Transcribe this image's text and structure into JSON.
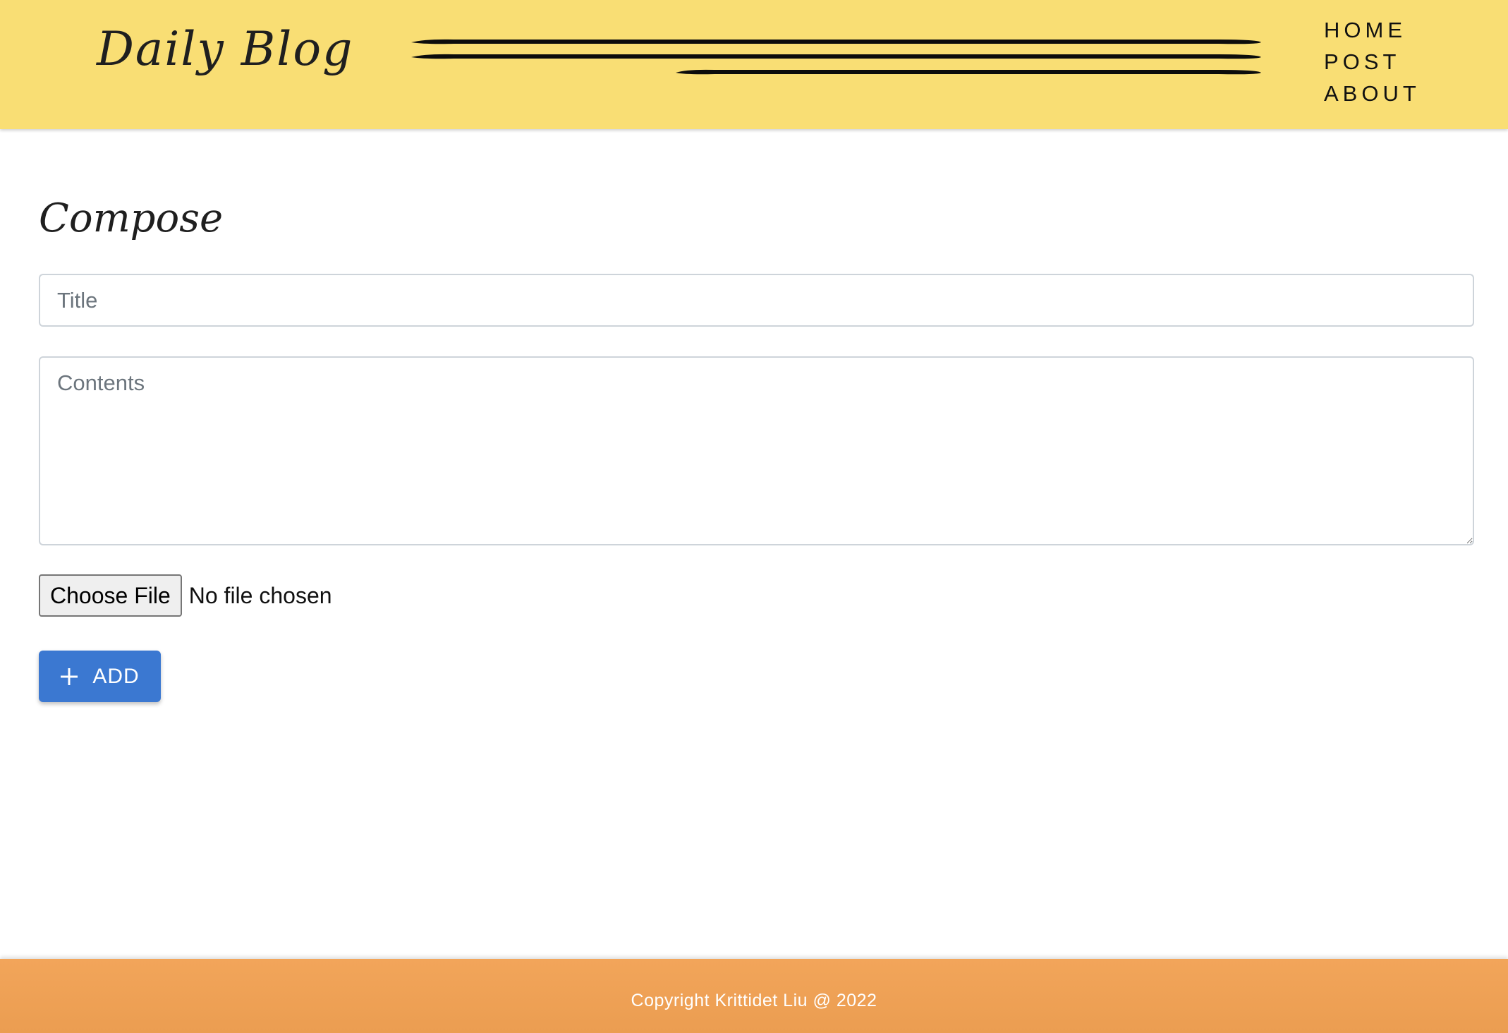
{
  "header": {
    "logo_text": "Daily Blog",
    "nav": {
      "home": "HOME",
      "post": "POST",
      "about": "ABOUT"
    },
    "background_color": "#f9de74"
  },
  "compose": {
    "page_title": "Compose",
    "title_placeholder": "Title",
    "title_value": "",
    "contents_placeholder": "Contents",
    "contents_value": "",
    "choose_file_label": "Choose File",
    "file_status": "No file chosen",
    "add_button": {
      "icon": "plus-icon",
      "label": "ADD",
      "color": "#3b78d1"
    }
  },
  "footer": {
    "text": "Copyright Krittidet Liu @ 2022",
    "background_color": "#f2a55a"
  }
}
